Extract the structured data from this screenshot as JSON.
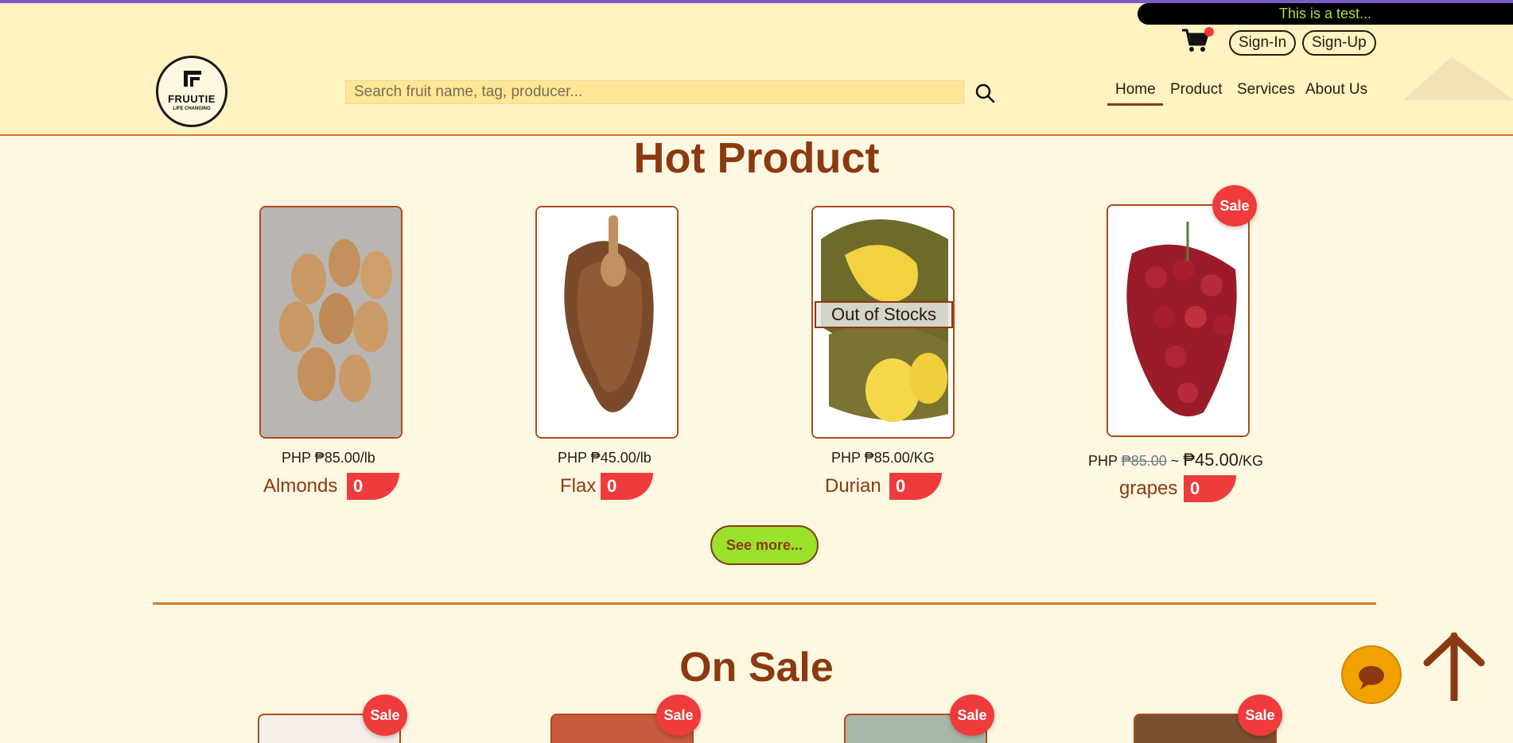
{
  "header": {
    "marquee_text": "This is a test...",
    "sign_in": "Sign-In",
    "sign_up": "Sign-Up",
    "logo_name": "FRUUTIE",
    "logo_tagline": "LIFE CHANGING",
    "search_placeholder": "Search fruit name, tag, producer...",
    "nav": [
      "Home",
      "Product",
      "Services",
      "About Us"
    ],
    "active_nav": "Home",
    "cart_icon": "cart-icon",
    "search_icon": "search-icon"
  },
  "hot_product": {
    "title": "Hot Product",
    "items": [
      {
        "name": "Almonds",
        "price": "PHP ₱85.00/lb",
        "qty": "0",
        "sale": false,
        "out_of_stock": false
      },
      {
        "name": "Flax",
        "price": "PHP ₱45.00/lb",
        "qty": "0",
        "sale": false,
        "out_of_stock": false
      },
      {
        "name": "Durian",
        "price": "PHP ₱85.00/KG",
        "qty": "0",
        "sale": false,
        "out_of_stock": true,
        "oos_label": "Out of Stocks"
      },
      {
        "name": "grapes",
        "price_prefix": "PHP",
        "old_price": "₱85.00",
        "tilde": "~",
        "new_price": "₱45.00",
        "unit": "/KG",
        "qty": "0",
        "sale": true,
        "sale_label": "Sale",
        "out_of_stock": false
      }
    ],
    "see_more": "See more..."
  },
  "on_sale": {
    "title": "On Sale",
    "badges": [
      "Sale",
      "Sale",
      "Sale",
      "Sale"
    ]
  },
  "floating": {
    "chat_icon": "chat-icon",
    "scroll_top_icon": "arrow-up-icon"
  },
  "colors": {
    "header_bg": "#fff3c2",
    "page_bg": "#fef8e3",
    "accent_brown": "#8b3a10",
    "sale_red": "#ef3b3b",
    "button_green": "#9be22c",
    "chat_orange": "#f3a100"
  }
}
